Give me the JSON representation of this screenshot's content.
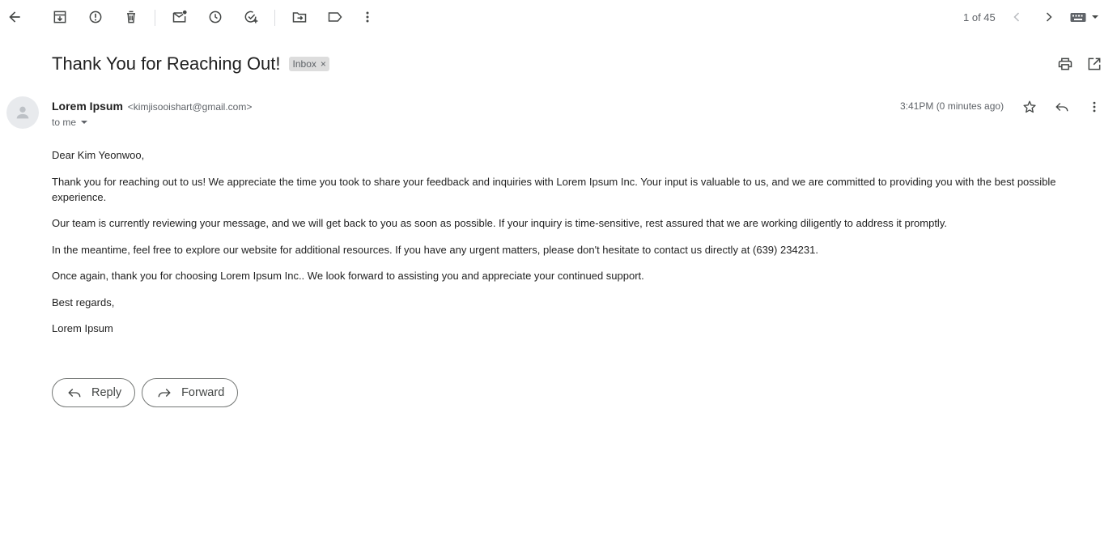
{
  "toolbar": {
    "icons": [
      "back-arrow-icon",
      "archive-icon",
      "report-spam-icon",
      "delete-icon",
      "mark-unread-icon",
      "snooze-icon",
      "add-to-tasks-icon",
      "move-to-icon",
      "label-icon",
      "more-vertical-icon"
    ],
    "pager_text": "1 of 45"
  },
  "message": {
    "subject": "Thank You for Reaching Out!",
    "label": "Inbox",
    "label_remove": "×",
    "sender_name": "Lorem Ipsum",
    "sender_email": "<kimjisooishart@gmail.com>",
    "to_text": "to me",
    "timestamp": "3:41PM (0 minutes ago)",
    "body": [
      "Dear Kim Yeonwoo,",
      "Thank you for reaching out to us! We appreciate the time you took to share your feedback and inquiries with Lorem Ipsum Inc. Your input is valuable to us, and we are committed to providing you with the best possible experience.",
      "Our team is currently reviewing your message, and we will get back to you as soon as possible. If your inquiry is time-sensitive, rest assured that we are working diligently to address it promptly.",
      "In the meantime, feel free to explore our website for additional resources. If you have any urgent matters, please don't hesitate to contact us directly at (639) 234231.",
      "Once again, thank you for choosing Lorem Ipsum Inc.. We look forward to assisting you and appreciate your continued support.",
      "Best regards,",
      "Lorem Ipsum"
    ]
  },
  "actions": {
    "reply_label": "Reply",
    "forward_label": "Forward"
  },
  "colors": {
    "icon": "#444746",
    "label_chip_bg": "#dddddd",
    "muted_text": "#5f6368"
  }
}
